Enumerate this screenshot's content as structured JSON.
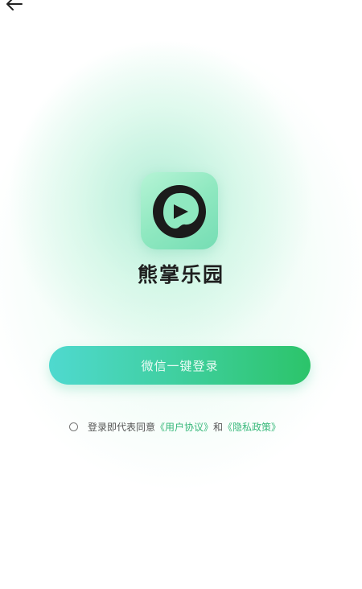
{
  "app": {
    "name": "熊掌乐园",
    "accent": "#2cc46a"
  },
  "nav": {
    "back_icon": "arrow-left-icon"
  },
  "login": {
    "wechat_button": "微信一键登录"
  },
  "agreement": {
    "prefix": "登录即代表同意",
    "user_agreement": "《用户协议》",
    "and": "和",
    "privacy_policy": "《隐私政策》"
  }
}
